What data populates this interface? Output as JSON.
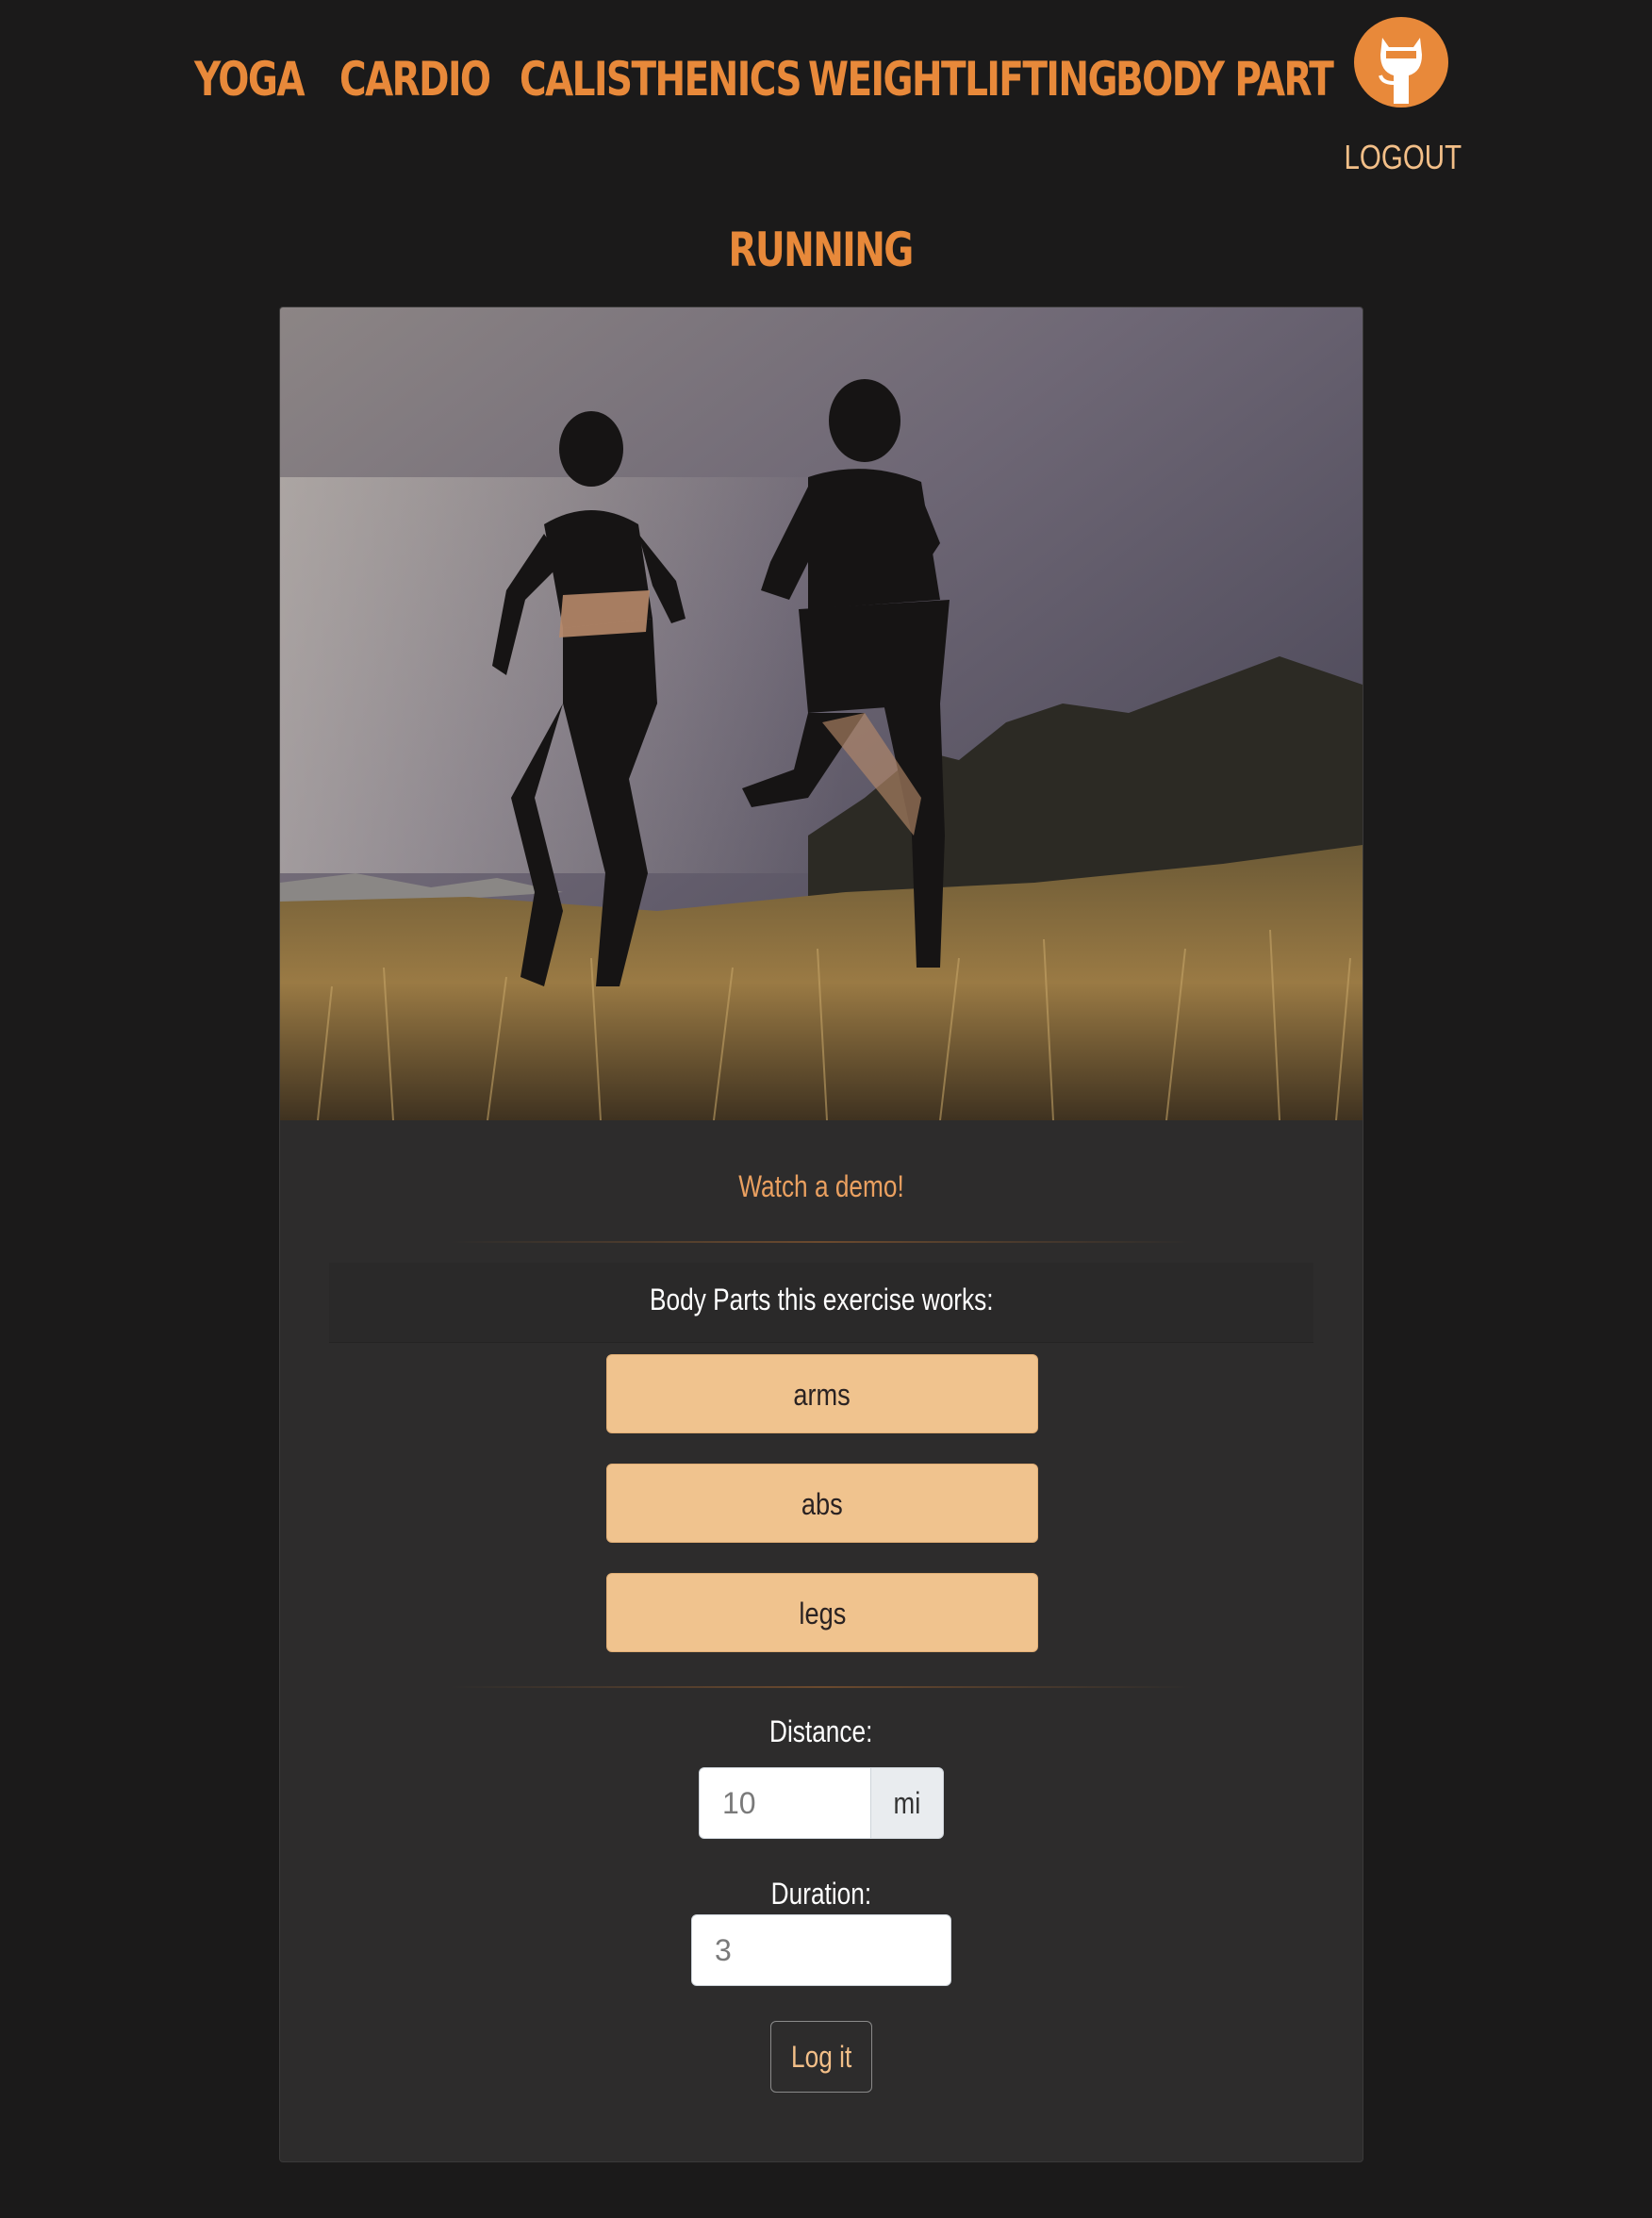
{
  "nav": {
    "items": [
      {
        "label": "YOGA"
      },
      {
        "label": "CARDIO"
      },
      {
        "label": "CALISTHENICS"
      },
      {
        "label": "WEIGHTLIFTING"
      },
      {
        "label": "BODY PART"
      }
    ],
    "logout_label": "LOGOUT",
    "avatar_icon": "octocat-icon"
  },
  "page": {
    "title": "RUNNING"
  },
  "card": {
    "demo_link": "Watch a demo!",
    "body_parts_title": "Body Parts this exercise works:",
    "body_parts": [
      "arms",
      "abs",
      "legs"
    ],
    "distance_label": "Distance:",
    "distance_value": "10",
    "distance_unit": "mi",
    "duration_label": "Duration:",
    "duration_value": "3",
    "submit_label": "Log it"
  },
  "colors": {
    "background": "#1b1a1a",
    "card": "#2d2c2c",
    "accent": "#e8893a",
    "button": "#f0c38e"
  }
}
